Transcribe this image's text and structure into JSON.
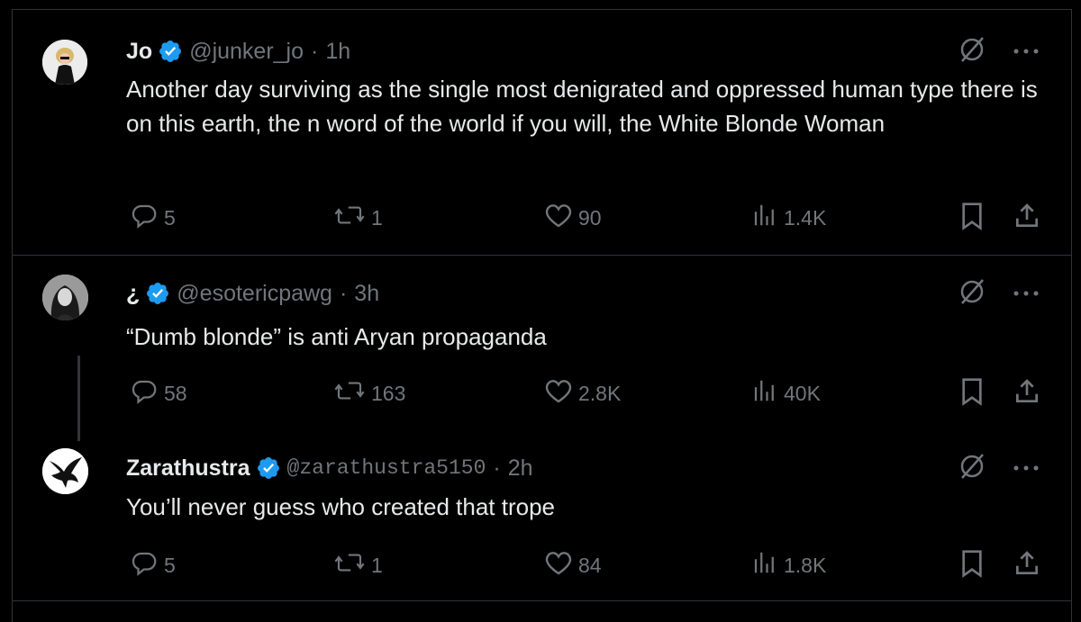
{
  "tweets": [
    {
      "name": "Jo",
      "handle": "@junker_jo",
      "separator": "·",
      "time": "1h",
      "text": "Another day surviving as the single most denigrated and oppressed human type there is on this earth, the n word of the world if you will, the White Blonde Woman",
      "replies": "5",
      "reposts": "1",
      "likes": "90",
      "views": "1.4K"
    },
    {
      "name": "¿",
      "handle": "@esotericpawg",
      "separator": "·",
      "time": "3h",
      "text": "“Dumb blonde” is anti Aryan propaganda",
      "replies": "58",
      "reposts": "163",
      "likes": "2.8K",
      "views": "40K"
    },
    {
      "name": "Zarathustra",
      "handle": "@zarathustra5150",
      "separator": "·",
      "time": "2h",
      "text": "You’ll never guess who created that trope",
      "replies": "5",
      "reposts": "1",
      "likes": "84",
      "views": "1.8K"
    }
  ],
  "icons": {
    "verified": "verified-badge-icon",
    "grok": "grok-icon",
    "more": "more-icon",
    "reply": "reply-icon",
    "repost": "repost-icon",
    "like": "like-icon",
    "views": "views-icon",
    "bookmark": "bookmark-icon",
    "share": "share-icon"
  },
  "colors": {
    "background": "#000000",
    "text": "#e7e9ea",
    "muted": "#71767b",
    "verified": "#1d9bf0",
    "border": "#2f3336"
  }
}
